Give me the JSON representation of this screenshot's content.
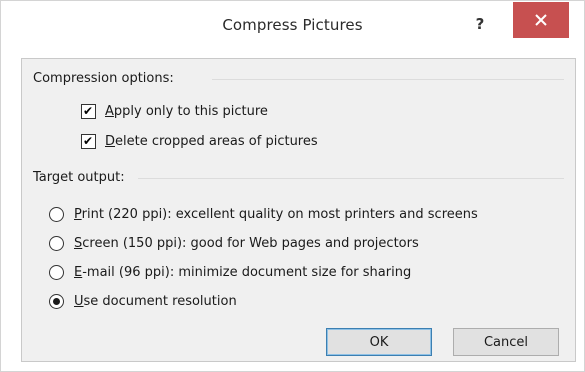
{
  "window": {
    "title": "Compress Pictures"
  },
  "controls": {
    "help_label": "?",
    "close_label": "×"
  },
  "compression_options": {
    "label": "Compression options:",
    "items": [
      {
        "accesskey": "A",
        "rest": "pply only to this picture",
        "checked": true
      },
      {
        "accesskey": "D",
        "rest": "elete cropped areas of pictures",
        "checked": true
      }
    ]
  },
  "target_output": {
    "label": "Target output:",
    "options": [
      {
        "accesskey": "P",
        "rest": "rint (220 ppi): excellent quality on most printers and screens",
        "selected": false
      },
      {
        "accesskey": "S",
        "rest": "creen (150 ppi): good for Web pages and projectors",
        "selected": false
      },
      {
        "accesskey": "E",
        "rest": "-mail (96 ppi): minimize document size for sharing",
        "selected": false
      },
      {
        "accesskey": "U",
        "rest": "se document resolution",
        "selected": true
      }
    ]
  },
  "buttons": {
    "ok": "OK",
    "cancel": "Cancel"
  },
  "colors": {
    "close_bg": "#c75050",
    "default_button_border": "#3c7fb1"
  }
}
